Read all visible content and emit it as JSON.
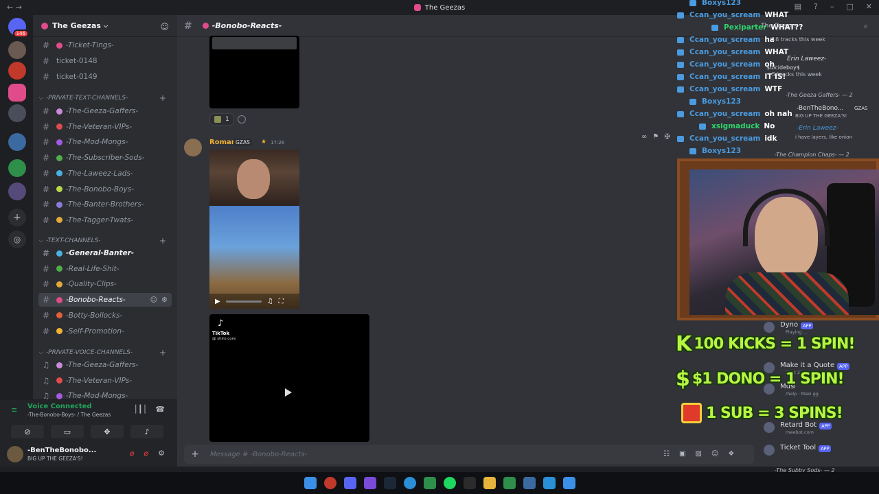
{
  "window": {
    "title": "The Geezas"
  },
  "rail": {
    "badge_count": "146"
  },
  "server": {
    "name": "The Geezas"
  },
  "channels": {
    "top": [
      {
        "name": "-Ticket-Tings-",
        "emoji_color": "#e04b8a"
      },
      {
        "name": "ticket-0148",
        "emoji_color": ""
      },
      {
        "name": "ticket-0149",
        "emoji_color": ""
      }
    ],
    "cat_private_text": "-PRIVATE-TEXT-CHANNELS-",
    "private_text": [
      {
        "name": "-The-Geeza-Gaffers-",
        "emoji_color": "#c98ad8"
      },
      {
        "name": "-The-Veteran-VIPs-",
        "emoji_color": "#e04b4b"
      },
      {
        "name": "-The-Mod-Mongs-",
        "emoji_color": "#a25be0"
      },
      {
        "name": "-The-Subscriber-Sods-",
        "emoji_color": "#4fae4a"
      },
      {
        "name": "-The-Laweez-Lads-",
        "emoji_color": "#4ab0e0"
      },
      {
        "name": "-The-Bonobo-Boys-",
        "emoji_color": "#b7d94a"
      },
      {
        "name": "-The-Banter-Brothers-",
        "emoji_color": "#8a7ad8"
      },
      {
        "name": "-The-Tagger-Twats-",
        "emoji_color": "#e0a93a"
      }
    ],
    "cat_text": "-TEXT-CHANNELS-",
    "text": [
      {
        "name": "-General-Banter-",
        "emoji_color": "#4ab0e0",
        "state": "unread"
      },
      {
        "name": "-Real-Life-Shit-",
        "emoji_color": "#4fae4a",
        "state": ""
      },
      {
        "name": "-Quality-Clips-",
        "emoji_color": "#e0a93a",
        "state": ""
      },
      {
        "name": "-Bonobo-Reacts-",
        "emoji_color": "#e04b8a",
        "state": "active"
      },
      {
        "name": "-Botty-Bollocks-",
        "emoji_color": "#e0603a",
        "state": ""
      },
      {
        "name": "-Self-Promotion-",
        "emoji_color": "#f0b232",
        "state": ""
      }
    ],
    "cat_private_voice": "-PRIVATE-VOICE-CHANNELS-",
    "private_voice": [
      {
        "name": "-The-Geeza-Gaffers-",
        "emoji_color": "#c98ad8"
      },
      {
        "name": "-The-Veteran-VIPs-",
        "emoji_color": "#e04b4b"
      },
      {
        "name": "-The-Mod-Mongs-",
        "emoji_color": "#a25be0"
      }
    ]
  },
  "voice": {
    "status": "Voice Connected",
    "location": "-The-Bonobo-Boys- / The Geezas"
  },
  "user": {
    "name": "-BenTheBonobo...",
    "status": "BIG UP THE GEEZA'S!"
  },
  "chat": {
    "channel": "-Bonobo-Reacts-",
    "reaction_count": "1",
    "message": {
      "author": "Roman",
      "tag": "GZAS",
      "time": "17:26"
    },
    "tiktok": {
      "brand": "TikTok",
      "user": "@ shiro.core"
    },
    "composer_placeholder": "Message #  -Bonobo-Reacts-"
  },
  "overlay": {
    "chat_lines": [
      {
        "nick": "Boxys123",
        "msg": "",
        "color": "blue"
      },
      {
        "nick": "Ccan_you_scream",
        "msg": "WHAT",
        "color": "blue"
      },
      {
        "nick": "Pexiparter",
        "msg": "WHAT??",
        "color": "green"
      },
      {
        "nick": "Ccan_you_scream",
        "msg": "ha",
        "color": "blue"
      },
      {
        "nick": "Ccan_you_scream",
        "msg": "WHAT",
        "color": "blue"
      },
      {
        "nick": "Ccan_you_scream",
        "msg": "oh",
        "color": "blue"
      },
      {
        "nick": "Ccan_you_scream",
        "msg": "IT IS!",
        "color": "blue"
      },
      {
        "nick": "Ccan_you_scream",
        "msg": "WTF",
        "color": "blue"
      },
      {
        "nick": "Boxys123",
        "msg": "",
        "color": "blue"
      },
      {
        "nick": "Ccan_you_scream",
        "msg": "oh nah",
        "color": "blue"
      },
      {
        "nick": "xsigmaduck",
        "msg": "No",
        "color": "green"
      },
      {
        "nick": "Ccan_you_scream",
        "msg": "idk",
        "color": "blue"
      },
      {
        "nick": "Boxys123",
        "msg": "",
        "color": "blue"
      }
    ],
    "members": {
      "header": "The Geezas",
      "tracks1": "16 tracks this week",
      "erin": "Erin Laweez-",
      "suicide": "$uicideboy$",
      "tracks2": "5 tracks this week",
      "group1": "-The Geeza Gaffers- — 2",
      "ben": "-BenTheBono...",
      "ben_tag": "GZAS",
      "ben_status": "BIG UP THE GEEZA'S!",
      "erin2": "-Erin Laweez-",
      "erin2_status": "i have layers, like onion",
      "group2": "-The Champion Chaps- — 2",
      "group3": "-The Subby Sods- — 2"
    },
    "promo": [
      {
        "lead": "K",
        "text": "100 KICKS = 1 SPIN!"
      },
      {
        "lead": "$",
        "text": "$1 DONO = 1 SPIN!"
      },
      {
        "lead": "",
        "text": "1 SUB = 3 SPINS!"
      }
    ],
    "bots": [
      {
        "name": "Dyno",
        "sub": "Playing ...",
        "app": "APP"
      },
      {
        "name": "Make it a Quote",
        "sub": "Sent 23rd hour",
        "app": "APP"
      },
      {
        "name": "Musi",
        "sub": "/help · Maki.gg",
        "app": ""
      },
      {
        "name": "Retard Bot",
        "sub": "meebot.com",
        "app": "APP"
      },
      {
        "name": "Ticket Tool",
        "sub": "",
        "app": "APP"
      }
    ]
  },
  "colors": {
    "accent": "#5865f2",
    "online": "#23a55a",
    "danger": "#f23f42",
    "author": "#f0b232"
  }
}
